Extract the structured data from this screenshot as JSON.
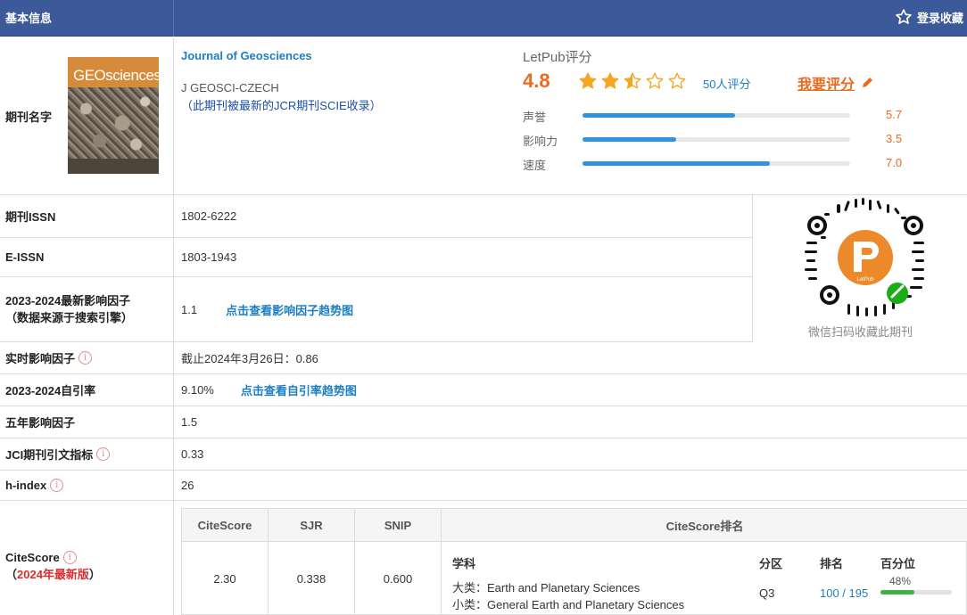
{
  "header": {
    "title": "基本信息",
    "fav_label": "登录收藏"
  },
  "journal": {
    "label": "期刊名字",
    "name": "Journal of Geosciences",
    "abbr": "J GEOSCI-CZECH",
    "note": "（此期刊被最新的JCR期刊SCIE收录）",
    "cover_title": "GEOsciences"
  },
  "letpub": {
    "title": "LetPub评分",
    "score": "4.8",
    "stars": 2.5,
    "count": "50人评分",
    "rate_label": "我要评分",
    "bars": [
      {
        "label": "声誉",
        "value": "5.7",
        "fraction": 0.57
      },
      {
        "label": "影响力",
        "value": "3.5",
        "fraction": 0.35
      },
      {
        "label": "速度",
        "value": "7.0",
        "fraction": 0.7
      }
    ]
  },
  "issn": {
    "label": "期刊ISSN",
    "value": "1802-6222"
  },
  "eissn": {
    "label": "E-ISSN",
    "value": "1803-1943"
  },
  "if": {
    "label_line1": "2023-2024最新影响因子",
    "label_line2": "（数据来源于搜索引擎）",
    "value": "1.1",
    "link": "点击查看影响因子趋势图"
  },
  "realtime_if": {
    "label": "实时影响因子",
    "value": "截止2024年3月26日：0.86"
  },
  "self_cite": {
    "label": "2023-2024自引率",
    "value": "9.10%",
    "link": "点击查看自引率趋势图"
  },
  "five_year_if": {
    "label": "五年影响因子",
    "value": "1.5"
  },
  "jci": {
    "label": "JCI期刊引文指标",
    "value": "0.33"
  },
  "h_index": {
    "label": "h-index",
    "value": "26"
  },
  "qr": {
    "caption": "微信扫码收藏此期刊",
    "logo_text": "LetPub"
  },
  "citescore": {
    "label": "CiteScore",
    "sub_prefix": "（",
    "sub_highlight": "2024年最新版",
    "sub_suffix": "）",
    "headers": [
      "CiteScore",
      "SJR",
      "SNIP",
      "CiteScore排名"
    ],
    "values": [
      "2.30",
      "0.338",
      "0.600"
    ],
    "rank_headers": [
      "学科",
      "分区",
      "排名",
      "百分位"
    ],
    "major_label": "大类：",
    "major": "Earth and Planetary Sciences",
    "minor_label": "小类：",
    "minor": "General Earth and Planetary Sciences",
    "quartile": "Q3",
    "rank": "100 / 195",
    "percentile": "48%",
    "percentile_fraction": 0.48
  },
  "colors": {
    "header_bg": "#3c5a9a",
    "accent_orange": "#ec6a1e",
    "link_blue": "#1d7ec4",
    "bar_blue": "#2f93e0"
  }
}
